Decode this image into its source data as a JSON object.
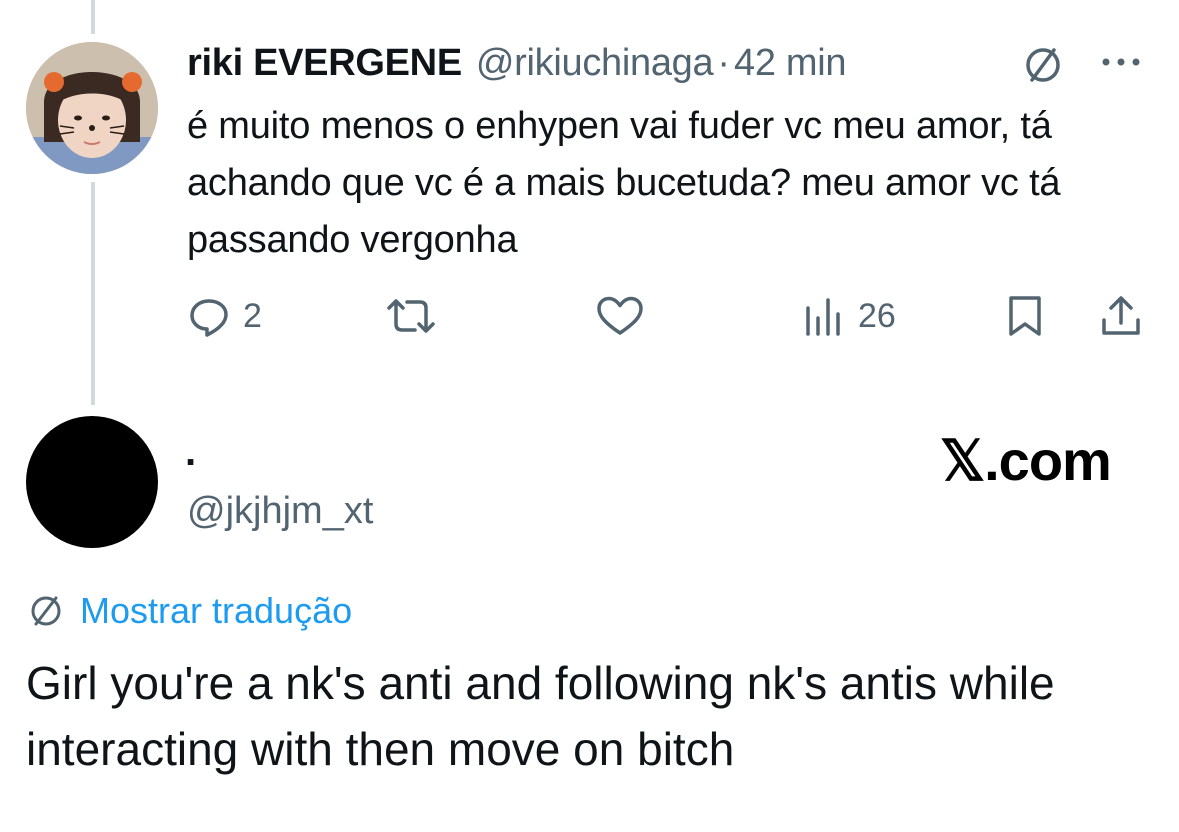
{
  "tweet1": {
    "author_name": "riki EVERGENE",
    "author_handle": "@rikiuchinaga",
    "separator": "·",
    "time": "42 min",
    "text": "é muito menos o enhypen vai fuder vc meu amor, tá achando que vc é a mais bucetuda? meu amor vc tá passando vergonha",
    "reply_count": "2",
    "view_count": "26",
    "icons": {
      "translate": "globe-translate-icon",
      "more": "more-icon",
      "reply": "reply-icon",
      "retweet": "retweet-icon",
      "like": "heart-icon",
      "views": "views-icon",
      "bookmark": "bookmark-icon",
      "share": "share-icon"
    }
  },
  "tweet2": {
    "author_name": ".",
    "author_handle": "@jkjhjm_xt",
    "watermark": "𝕏.com",
    "translate_label": "Mostrar tradução",
    "text": "Girl you're a nk's anti and following nk's antis while interacting with then move on bitch"
  },
  "colors": {
    "text": "#0f1419",
    "secondary": "#536471",
    "accent": "#1d9bf0",
    "thread_line": "#cfd9de"
  }
}
